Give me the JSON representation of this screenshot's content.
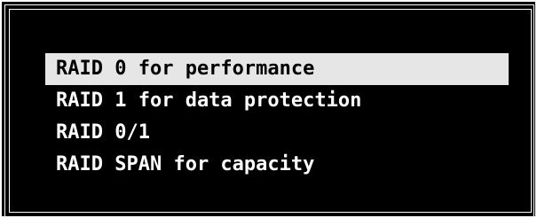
{
  "menu": {
    "selected_index": 0,
    "items": [
      {
        "label": "RAID 0 for performance"
      },
      {
        "label": "RAID 1 for data protection"
      },
      {
        "label": "RAID 0/1"
      },
      {
        "label": "RAID SPAN for capacity"
      }
    ]
  },
  "colors": {
    "background": "#000000",
    "text": "#ffffff",
    "highlight_bg": "#e6e6e6",
    "highlight_text": "#000000"
  }
}
